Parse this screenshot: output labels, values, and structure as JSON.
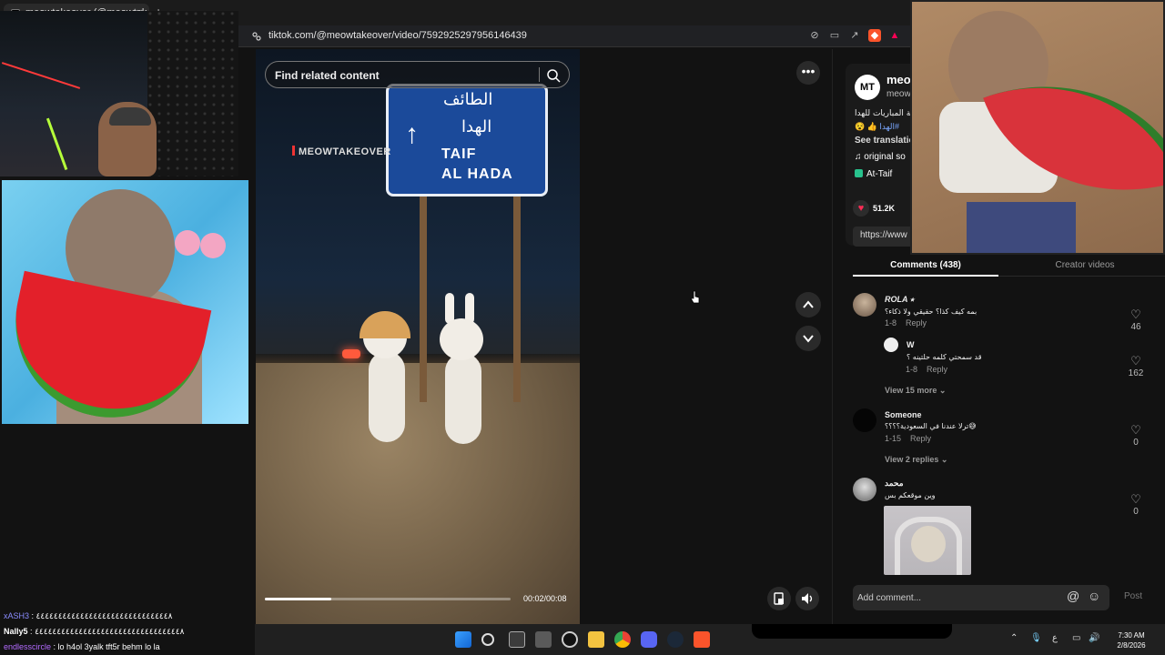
{
  "browser": {
    "tab_title": "meowtakeover (@meowtak",
    "url": "tiktok.com/@meowtakeover/video/7592925297956146439"
  },
  "video": {
    "search_placeholder": "Find related content",
    "watermark": "MEOWTAKEOVER",
    "sign": {
      "arabic_line1": "الطائف",
      "arabic_line2": "الهدا",
      "english_line1": "TAIF",
      "english_line2": "AL HADA"
    },
    "time": "00:02/00:08",
    "progress": 0.27
  },
  "controls": {
    "more_icon": "more-icon",
    "up_icon": "chevron-up-icon",
    "down_icon": "chevron-down-icon",
    "volume_icon": "volume-icon",
    "pip_icon": "pip-icon"
  },
  "creator": {
    "avatar": "MT",
    "name": "meo",
    "handle": "meow",
    "description_ar": "جة المباريات للهدا",
    "tags": "الهدا#",
    "see_translation": "See translatio",
    "sound": "original so",
    "location": "At-Taif",
    "likes": "51.2K",
    "link": "https://www"
  },
  "tabs": {
    "comments": "Comments (438)",
    "creator_videos": "Creator videos"
  },
  "comments": [
    {
      "name": "ROLA ⭑",
      "text": "بمه كيف كذا؟ حقيقي ولا ذكاء؟",
      "date": "1-8",
      "reply": "Reply",
      "likes": "46"
    },
    {
      "name": "W",
      "text": "قد سمحتي كلمه حلتينه ؟",
      "date": "1-8",
      "reply": "Reply",
      "likes": "162"
    },
    {
      "name": "Someone",
      "text": "ترلا عندنا في السعودية؟؟؟؟😅",
      "date": "1-15",
      "reply": "Reply",
      "likes": "0"
    },
    {
      "name": "محمد",
      "text": "وين موقعكم بس",
      "likes": "0"
    }
  ],
  "view_more": {
    "first": "View 15 more",
    "second": "View 2 replies"
  },
  "add_comment": {
    "placeholder": "Add comment...",
    "post": "Post"
  },
  "chat": [
    {
      "user": "xASH3",
      "msg": ": ٤٤٤٤٤٤٤٤٤٤٤٤٤٤٤٤٤٤٤٤٤٤٤٤٤٤٤٤٤٤٨"
    },
    {
      "user": "Nally5",
      "msg": ": ٤٤٤٤٤٤٤٤٤٤٤٤٤٤٤٤٤٤٤٤٤٤٤٤٤٤٤٤٤٤٤٤٤٨"
    },
    {
      "user": "endlesscircle",
      "msg": ": lo h4ol 3yalk tft5r behm lo la"
    }
  ],
  "taskbar": {
    "time": "7:30 AM",
    "date": "2/8/2026",
    "lang": "ع"
  }
}
